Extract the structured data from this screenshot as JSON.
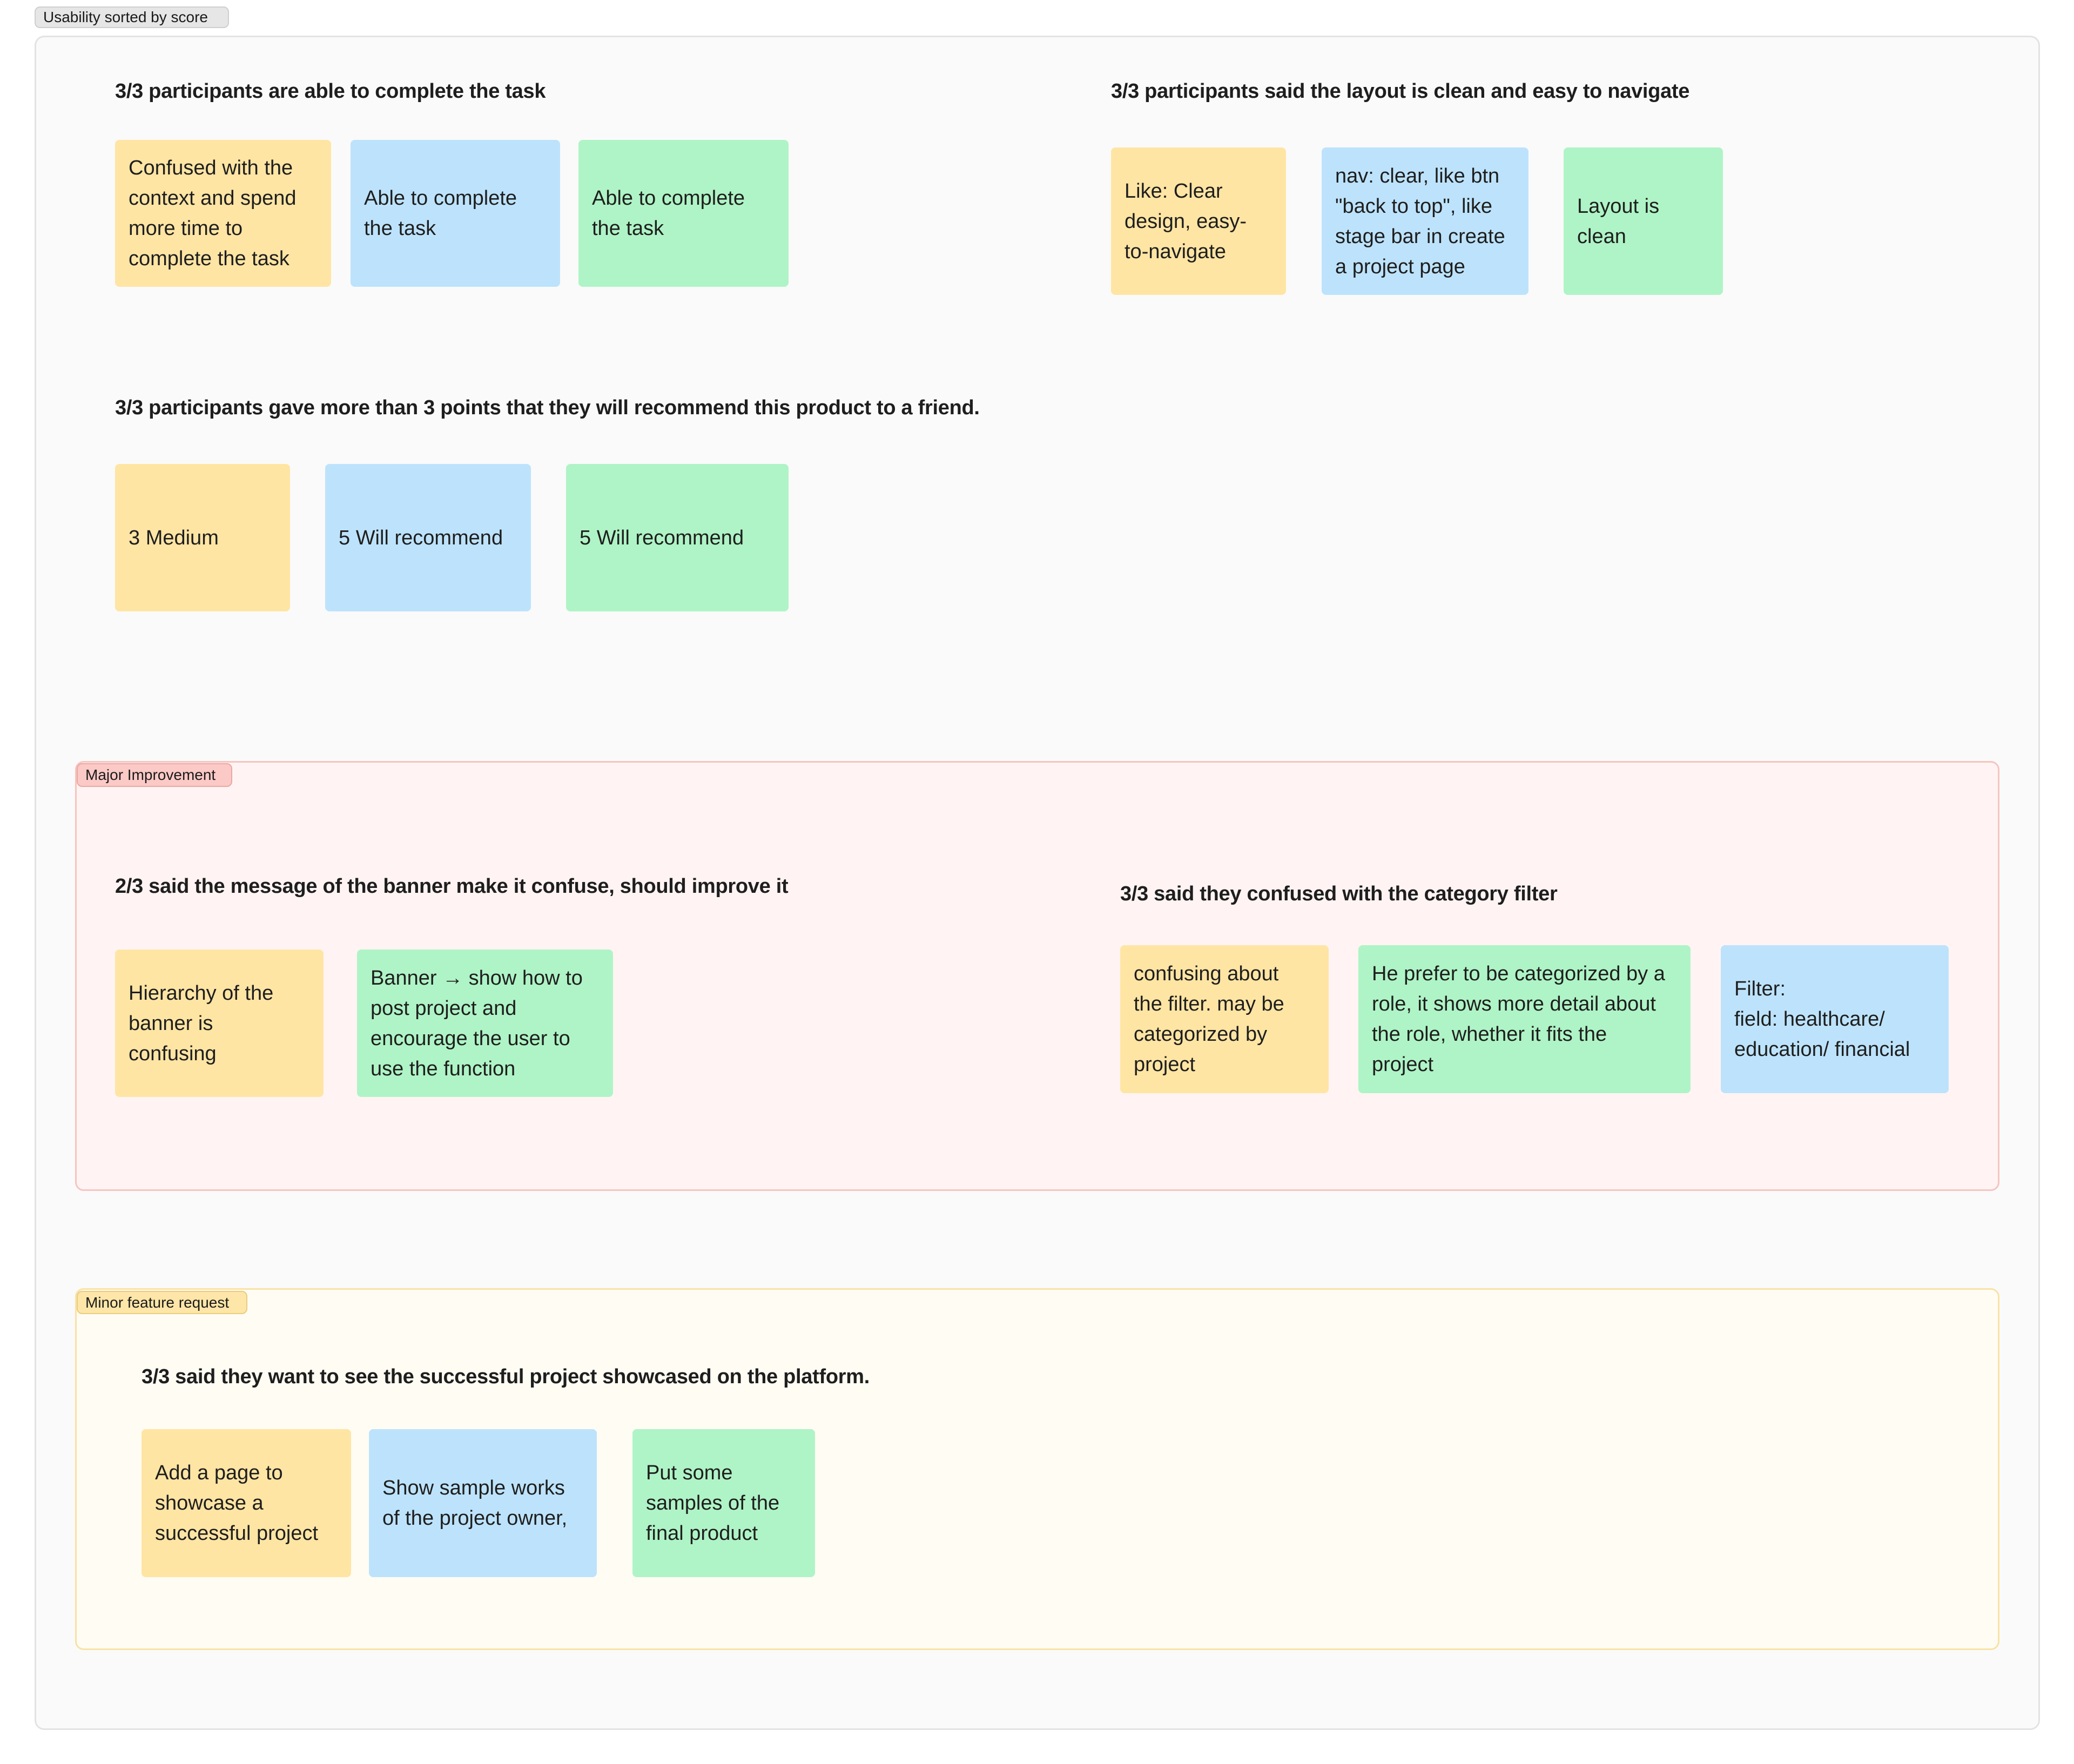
{
  "frame": {
    "label": "Usability sorted by score"
  },
  "usability": {
    "groups": [
      {
        "heading": "3/3 participants are able to complete the task",
        "notes": [
          {
            "text": "Confused with the\ncontext and spend\nmore time to\ncomplete the task",
            "color": "yellow"
          },
          {
            "text": "Able to complete\nthe task",
            "color": "blue"
          },
          {
            "text": "Able to complete\nthe task",
            "color": "green"
          }
        ]
      },
      {
        "heading": "3/3 participants said the layout is clean and easy to navigate",
        "notes": [
          {
            "text": "Like: Clear\ndesign, easy-\nto-navigate",
            "color": "yellow"
          },
          {
            "text": "nav: clear, like btn\n\"back to top\", like\nstage bar in create\na project page",
            "color": "blue"
          },
          {
            "text": "Layout is\nclean",
            "color": "green"
          }
        ]
      },
      {
        "heading": "3/3 participants gave more than 3 points that they will recommend this product to a friend.",
        "notes": [
          {
            "text": "3 Medium",
            "color": "yellow"
          },
          {
            "text": "5 Will recommend",
            "color": "blue"
          },
          {
            "text": "5 Will recommend",
            "color": "green"
          }
        ]
      }
    ]
  },
  "major": {
    "label": "Major Improvement",
    "groups": [
      {
        "heading": "2/3 said the message of the banner make it confuse, should improve it",
        "notes": [
          {
            "text": "Hierarchy of the\nbanner is\nconfusing",
            "color": "yellow"
          },
          {
            "text": "Banner → show how to\npost project and\nencourage the user to\nuse the function",
            "color": "green"
          }
        ]
      },
      {
        "heading": "3/3 said they confused with the category filter",
        "notes": [
          {
            "text": "confusing about\nthe filter. may be\ncategorized by\nproject",
            "color": "yellow"
          },
          {
            "text": "He prefer to be categorized by a\nrole, it shows more detail about\nthe role, whether it fits the\nproject",
            "color": "green"
          },
          {
            "text": "Filter:\nfield: healthcare/\neducation/ financial",
            "color": "blue"
          }
        ]
      }
    ]
  },
  "minor": {
    "label": "Minor feature request",
    "groups": [
      {
        "heading": "3/3 said they want to see the successful project showcased on the platform.",
        "notes": [
          {
            "text": "Add a page to\nshowcase a\nsuccessful project",
            "color": "yellow"
          },
          {
            "text": "Show sample works\nof the project owner,",
            "color": "blue"
          },
          {
            "text": "Put some\nsamples of the\nfinal product",
            "color": "green"
          }
        ]
      }
    ]
  },
  "colors": {
    "yellow": "#ffe5a4",
    "blue": "#bde3fc",
    "green": "#aff4c6",
    "major_bg": "#fff4f3",
    "minor_bg": "#fffcf3"
  }
}
